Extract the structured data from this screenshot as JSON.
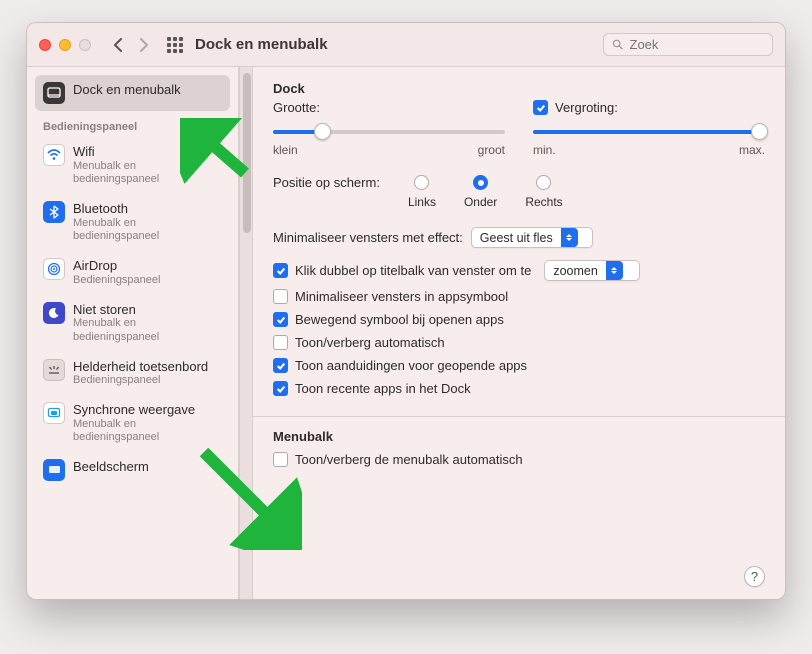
{
  "header": {
    "title": "Dock en menubalk",
    "search_placeholder": "Zoek"
  },
  "sidebar": {
    "selected": {
      "label": "Dock en menubalk"
    },
    "group_header": "Bedieningspaneel",
    "items": [
      {
        "label": "Wifi",
        "sub": "Menubalk en bedieningspaneel"
      },
      {
        "label": "Bluetooth",
        "sub": "Menubalk en bedieningspaneel"
      },
      {
        "label": "AirDrop",
        "sub": "Bedieningspaneel"
      },
      {
        "label": "Niet storen",
        "sub": "Menubalk en bedieningspaneel"
      },
      {
        "label": "Helderheid toetsenbord",
        "sub": "Bedieningspaneel"
      },
      {
        "label": "Synchrone weergave",
        "sub": "Menubalk en bedieningspaneel"
      },
      {
        "label": "Beeldscherm",
        "sub": ""
      }
    ]
  },
  "dock": {
    "section_title": "Dock",
    "size": {
      "label": "Grootte:",
      "min": "klein",
      "max": "groot",
      "value_pct": 21
    },
    "magnification": {
      "label": "Vergroting:",
      "checked": true,
      "min": "min.",
      "max": "max.",
      "value_pct": 100
    },
    "position": {
      "label": "Positie op scherm:",
      "options": [
        "Links",
        "Onder",
        "Rechts"
      ],
      "selected": "Onder"
    },
    "minimize_effect": {
      "label": "Minimaliseer vensters met effect:",
      "value": "Geest uit fles"
    },
    "doubleclick": {
      "label": "Klik dubbel op titelbalk van venster om te",
      "checked": true,
      "select_value": "zoomen"
    },
    "options": [
      {
        "checked": false,
        "label": "Minimaliseer vensters in appsymbool"
      },
      {
        "checked": true,
        "label": "Bewegend symbool bij openen apps"
      },
      {
        "checked": false,
        "label": "Toon/verberg automatisch"
      },
      {
        "checked": true,
        "label": "Toon aanduidingen voor geopende apps"
      },
      {
        "checked": true,
        "label": "Toon recente apps in het Dock"
      }
    ]
  },
  "menubar": {
    "section_title": "Menubalk",
    "autohide": {
      "checked": false,
      "label": "Toon/verberg de menubalk automatisch"
    }
  },
  "help_tooltip": "?"
}
